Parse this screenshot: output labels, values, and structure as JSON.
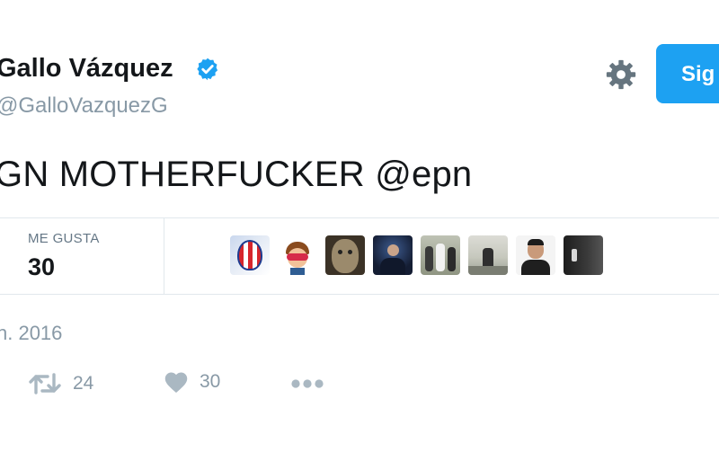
{
  "user": {
    "name": "Gallo Vázquez",
    "handle": "@GalloVazquezG"
  },
  "follow_button": {
    "label": "Sig"
  },
  "tweet": {
    "text": "GN MOTHERFUCKER @epn",
    "date": "n. 2016"
  },
  "stats": {
    "likes_label": "ME GUSTA",
    "likes_count": "30"
  },
  "actions": {
    "retweets": "24",
    "likes": "30"
  },
  "colors": {
    "accent": "#1da1f2",
    "muted": "#8899a6",
    "text": "#14171a",
    "divider": "#e1e8ed"
  },
  "icons": [
    "verified-badge-icon",
    "gear-icon",
    "retweet-icon",
    "heart-icon",
    "more-icon"
  ]
}
